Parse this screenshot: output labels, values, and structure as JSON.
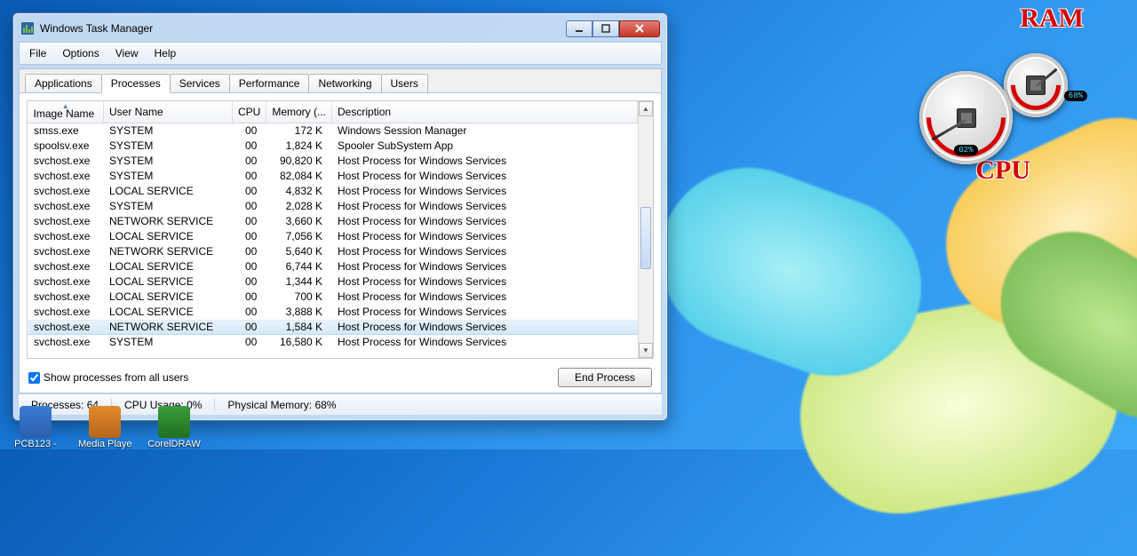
{
  "window": {
    "title": "Windows Task Manager"
  },
  "menu": [
    "File",
    "Options",
    "View",
    "Help"
  ],
  "tabs": [
    "Applications",
    "Processes",
    "Services",
    "Performance",
    "Networking",
    "Users"
  ],
  "active_tab": "Processes",
  "columns": {
    "image_name": "Image Name",
    "user_name": "User Name",
    "cpu": "CPU",
    "memory": "Memory (...",
    "description": "Description"
  },
  "processes": [
    {
      "image": "smss.exe",
      "user": "SYSTEM",
      "cpu": "00",
      "mem": "172 K",
      "desc": "Windows Session Manager",
      "sel": false
    },
    {
      "image": "spoolsv.exe",
      "user": "SYSTEM",
      "cpu": "00",
      "mem": "1,824 K",
      "desc": "Spooler SubSystem App",
      "sel": false
    },
    {
      "image": "svchost.exe",
      "user": "SYSTEM",
      "cpu": "00",
      "mem": "90,820 K",
      "desc": "Host Process for Windows Services",
      "sel": false
    },
    {
      "image": "svchost.exe",
      "user": "SYSTEM",
      "cpu": "00",
      "mem": "82,084 K",
      "desc": "Host Process for Windows Services",
      "sel": false
    },
    {
      "image": "svchost.exe",
      "user": "LOCAL SERVICE",
      "cpu": "00",
      "mem": "4,832 K",
      "desc": "Host Process for Windows Services",
      "sel": false
    },
    {
      "image": "svchost.exe",
      "user": "SYSTEM",
      "cpu": "00",
      "mem": "2,028 K",
      "desc": "Host Process for Windows Services",
      "sel": false
    },
    {
      "image": "svchost.exe",
      "user": "NETWORK SERVICE",
      "cpu": "00",
      "mem": "3,660 K",
      "desc": "Host Process for Windows Services",
      "sel": false
    },
    {
      "image": "svchost.exe",
      "user": "LOCAL SERVICE",
      "cpu": "00",
      "mem": "7,056 K",
      "desc": "Host Process for Windows Services",
      "sel": false
    },
    {
      "image": "svchost.exe",
      "user": "NETWORK SERVICE",
      "cpu": "00",
      "mem": "5,640 K",
      "desc": "Host Process for Windows Services",
      "sel": false
    },
    {
      "image": "svchost.exe",
      "user": "LOCAL SERVICE",
      "cpu": "00",
      "mem": "6,744 K",
      "desc": "Host Process for Windows Services",
      "sel": false
    },
    {
      "image": "svchost.exe",
      "user": "LOCAL SERVICE",
      "cpu": "00",
      "mem": "1,344 K",
      "desc": "Host Process for Windows Services",
      "sel": false
    },
    {
      "image": "svchost.exe",
      "user": "LOCAL SERVICE",
      "cpu": "00",
      "mem": "700 K",
      "desc": "Host Process for Windows Services",
      "sel": false
    },
    {
      "image": "svchost.exe",
      "user": "LOCAL SERVICE",
      "cpu": "00",
      "mem": "3,888 K",
      "desc": "Host Process for Windows Services",
      "sel": false
    },
    {
      "image": "svchost.exe",
      "user": "NETWORK SERVICE",
      "cpu": "00",
      "mem": "1,584 K",
      "desc": "Host Process for Windows Services",
      "sel": true
    },
    {
      "image": "svchost.exe",
      "user": "SYSTEM",
      "cpu": "00",
      "mem": "16,580 K",
      "desc": "Host Process for Windows Services",
      "sel": false
    }
  ],
  "show_all": {
    "label": "Show processes from all users",
    "checked": true
  },
  "end_process_label": "End Process",
  "status": {
    "processes": "Processes: 64",
    "cpu": "CPU Usage: 0%",
    "memory": "Physical Memory: 68%"
  },
  "gadget": {
    "ram_label": "RAM",
    "cpu_label": "CPU",
    "cpu_value": "02%",
    "ram_value": "68%"
  },
  "desktop": [
    {
      "name": "PCB123 -"
    },
    {
      "name": "Media Player"
    },
    {
      "name": "CorelDRAW"
    }
  ]
}
